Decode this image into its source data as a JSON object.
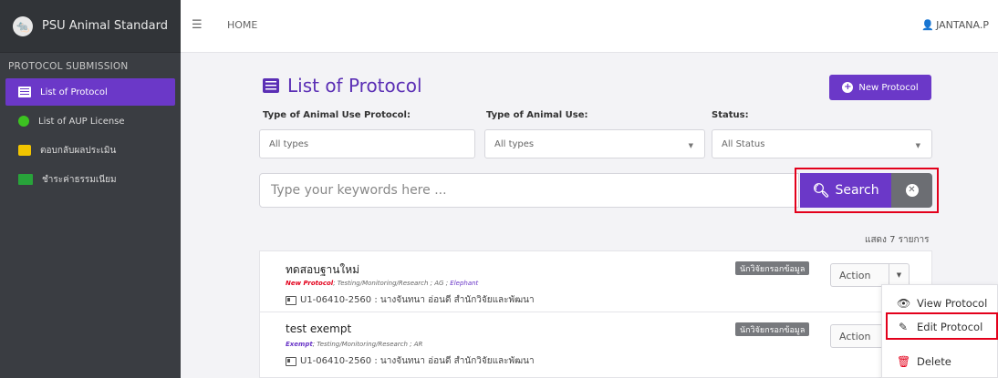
{
  "app": {
    "title": "PSU Animal Standard"
  },
  "sidebar": {
    "section": "PROTOCOL SUBMISSION",
    "items": [
      {
        "label": "List of Protocol",
        "icon": "list-icon",
        "active": true
      },
      {
        "label": "List of AUP License",
        "icon": "badge-icon",
        "active": false
      },
      {
        "label": "ตอบกลับผลประเมิน",
        "icon": "comment-icon",
        "active": false
      },
      {
        "label": "ชำระค่าธรรมเนียม",
        "icon": "money-icon",
        "active": false
      }
    ]
  },
  "topbar": {
    "home": "HOME",
    "user": "JANTANA.P"
  },
  "main": {
    "title": "List of Protocol",
    "new_button": "New Protocol",
    "filters": {
      "protocol_type": {
        "label": "Type of Animal Use Protocol:",
        "value": "All types"
      },
      "animal_use": {
        "label": "Type of Animal Use:",
        "value": "All types"
      },
      "status": {
        "label": "Status:",
        "value": "All Status"
      }
    },
    "search": {
      "placeholder": "Type your keywords here ...",
      "button": "Search"
    },
    "count_text": "แสดง 7 รายการ",
    "protocols": [
      {
        "title": "ทดสอบฐานใหม่",
        "type": "New Protocol",
        "meta": "; Testing/Monitoring/Research ; AG ; ",
        "animal": "Elephant",
        "id_line": "U1-06410-2560 :  นางจันทนา อ่อนดี  สำนักวิจัยและพัฒนา",
        "badge": "นักวิจัยกรอกข้อมูล",
        "action": "Action"
      },
      {
        "title": "test exempt",
        "type": "Exempt",
        "meta": "; Testing/Monitoring/Research ; AR",
        "animal": "",
        "id_line": "U1-06410-2560 :  นางจันทนา อ่อนดี  สำนักวิจัยและพัฒนา",
        "badge": "นักวิจัยกรอกข้อมูล",
        "action": "Action"
      }
    ],
    "dropdown": [
      "View Protocol",
      "Edit Protocol",
      "Delete"
    ]
  },
  "colors": {
    "accent": "#6b38c8",
    "sidebar": "#3a3d42",
    "highlight": "#e3001b"
  }
}
